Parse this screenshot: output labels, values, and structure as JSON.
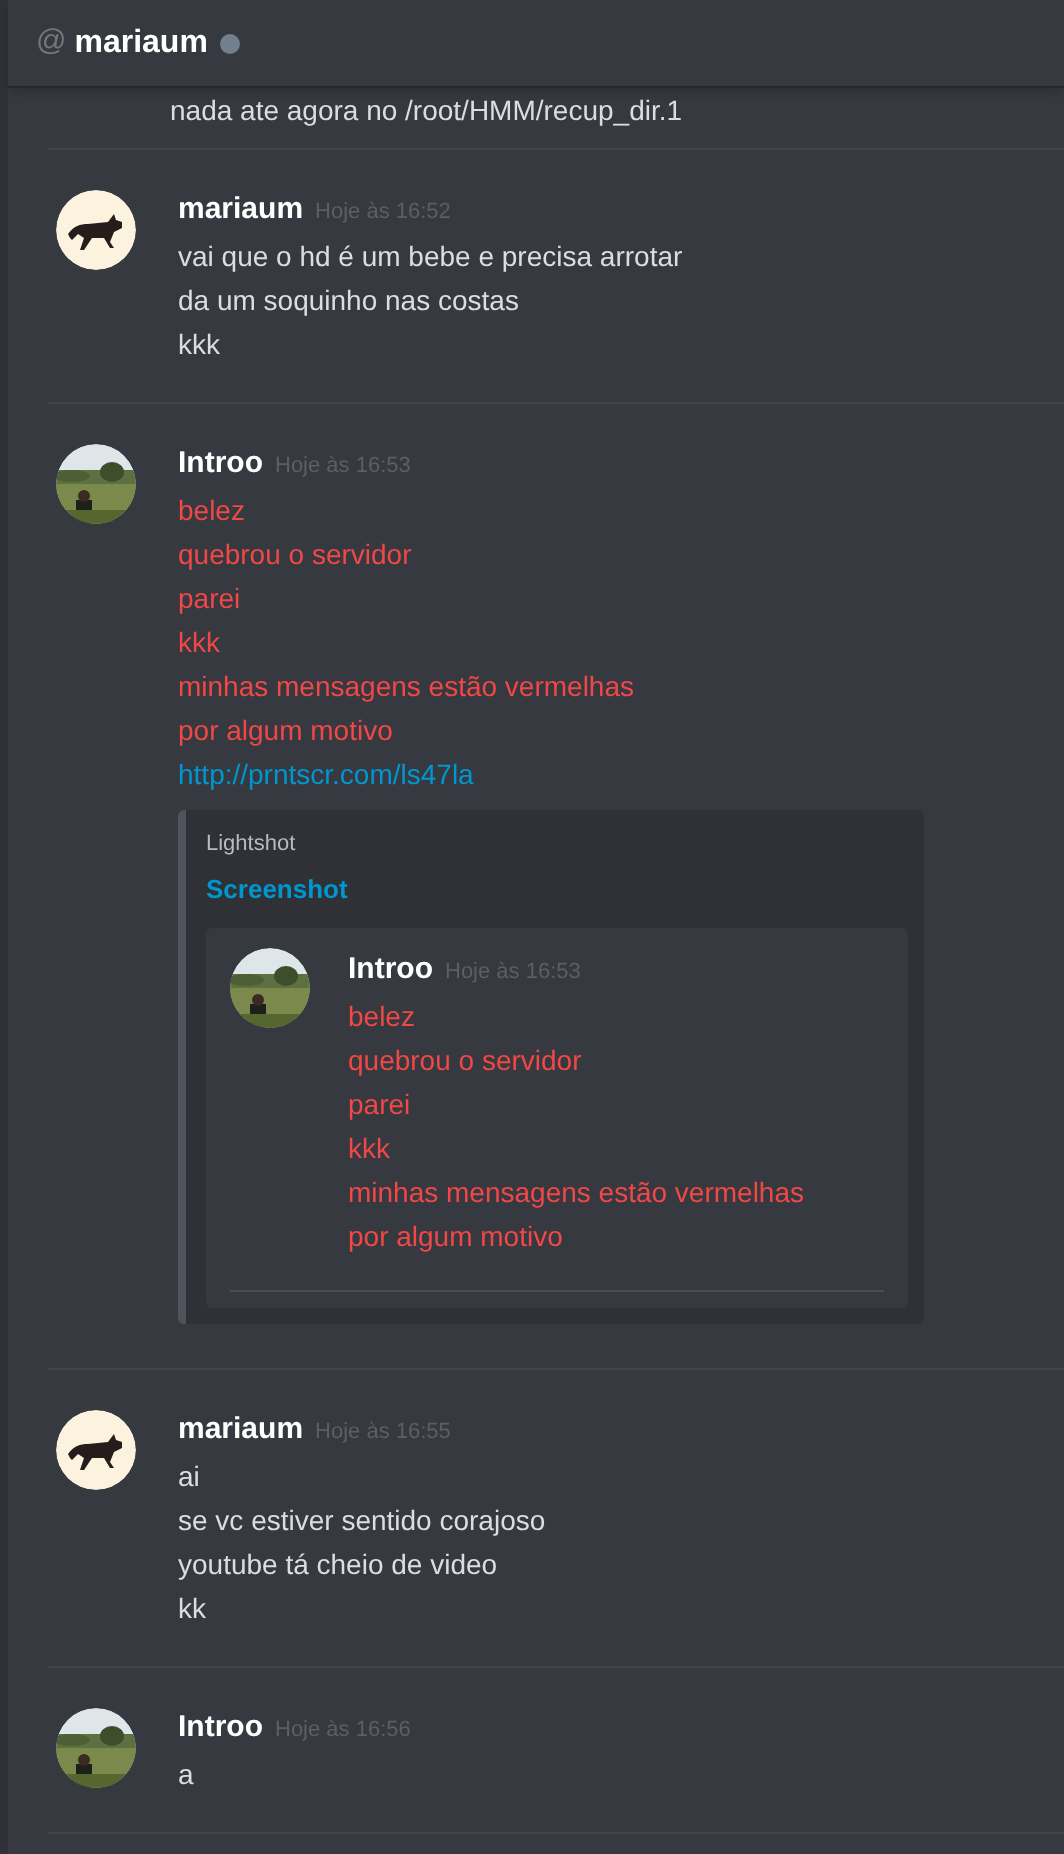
{
  "header": {
    "prefix": "@",
    "username": "mariaum",
    "online": false
  },
  "messages": [
    {
      "kind": "continuation",
      "color": "#dcddde",
      "lines": [
        "nada ate agora no /root/HMM/recup_dir.1"
      ]
    },
    {
      "kind": "message",
      "avatar": {
        "kind": "picture",
        "color": "#fbf3de"
      },
      "author": "mariaum",
      "timestamp": "Hoje às 16:52",
      "color": "#dcddde",
      "lines": [
        "vai que o hd é um bebe e precisa arrotar",
        "da um soquinho nas costas",
        "kkk"
      ]
    },
    {
      "kind": "message",
      "avatar": {
        "kind": "picture",
        "color": "#5d7042"
      },
      "author": "Introo",
      "timestamp": "Hoje às 16:53",
      "color": "#f04747",
      "lines": [
        "belez",
        "quebrou o servidor",
        "parei",
        "kkk",
        "minhas mensagens estão vermelhas",
        "por algum motivo"
      ],
      "link": "http://prntscr.com/ls47la",
      "embed": {
        "provider": "Lightshot",
        "title": "Screenshot",
        "image": {
          "avatar": {
            "kind": "picture",
            "color": "#5d7042"
          },
          "author": "Introo",
          "timestamp": "Hoje às 16:53",
          "color": "#f04747",
          "lines": [
            "belez",
            "quebrou o servidor",
            "parei",
            "kkk",
            "minhas mensagens estão vermelhas",
            "por algum motivo"
          ]
        }
      }
    },
    {
      "kind": "message",
      "avatar": {
        "kind": "picture",
        "color": "#fbf3de"
      },
      "author": "mariaum",
      "timestamp": "Hoje às 16:55",
      "color": "#dcddde",
      "lines": [
        "ai",
        "se vc estiver sentido corajoso",
        "youtube tá cheio de video",
        "kk"
      ]
    },
    {
      "kind": "message",
      "avatar": {
        "kind": "picture",
        "color": "#5d7042"
      },
      "author": "Introo",
      "timestamp": "Hoje às 16:56",
      "color": "#dcddde",
      "lines": [
        "a"
      ]
    }
  ]
}
